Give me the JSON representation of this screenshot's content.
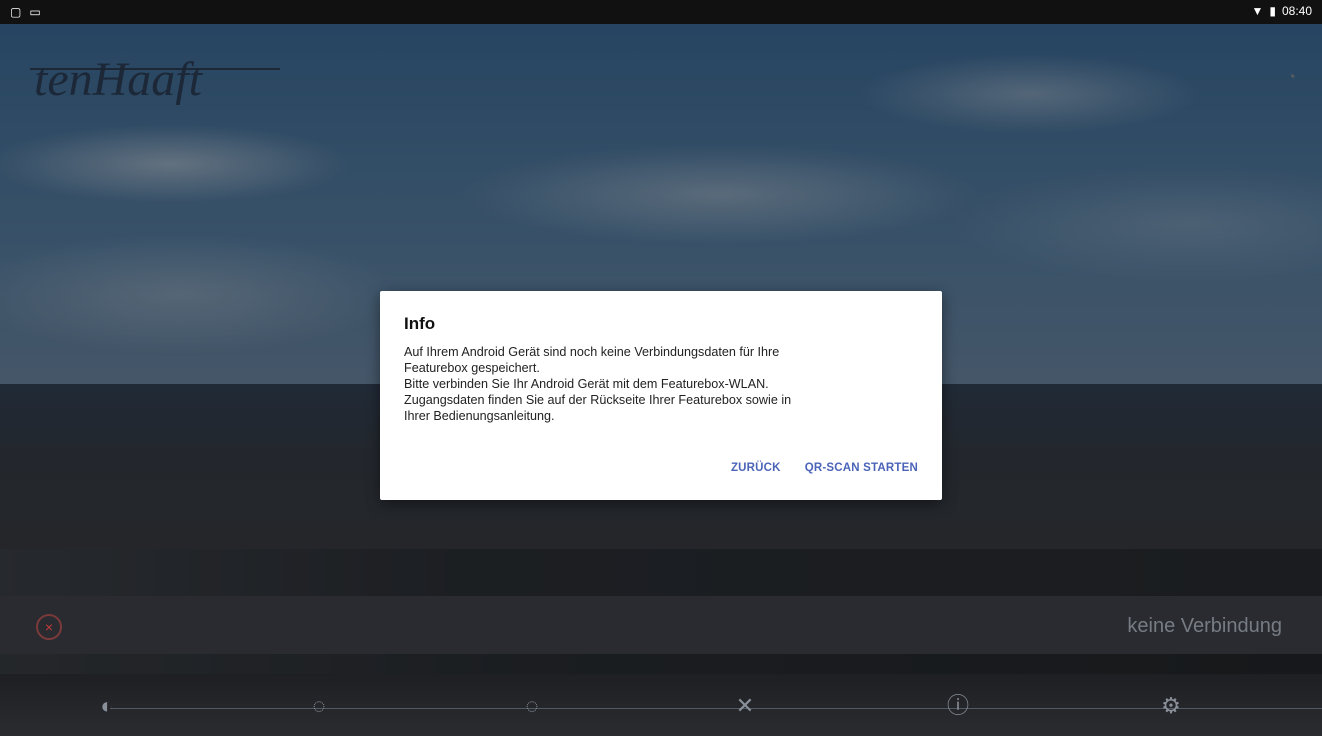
{
  "status": {
    "time": "08:40",
    "left_icons": [
      "square-icon",
      "screen-icon"
    ],
    "right_icons": [
      "wifi-icon",
      "battery-icon"
    ]
  },
  "brand": {
    "logo_text": "tenHaaft"
  },
  "header": {
    "rss_icon": "rss-icon"
  },
  "dialog": {
    "title": "Info",
    "body": "Auf Ihrem Android Gerät sind noch keine Verbindungsdaten für Ihre\nFeaturebox gespeichert.\nBitte verbinden Sie Ihr Android Gerät mit dem Featurebox-WLAN.\nZugangsdaten finden Sie auf der Rückseite Ihrer Featurebox sowie in\nIhrer Bedienungsanleitung.",
    "back_label": "ZURÜCK",
    "scan_label": "QR-SCAN STARTEN",
    "accent": "#4b64b8"
  },
  "connection": {
    "status_text": "keine Verbindung",
    "status_icon": "disconnected-icon"
  },
  "nav": {
    "items": [
      {
        "icon": "satellite-signal-icon"
      },
      {
        "icon": "satellite-warning-icon"
      },
      {
        "icon": "satellite-off-icon"
      },
      {
        "icon": "satellite-icon"
      },
      {
        "icon": "info-icon"
      },
      {
        "icon": "settings-icon"
      }
    ]
  }
}
